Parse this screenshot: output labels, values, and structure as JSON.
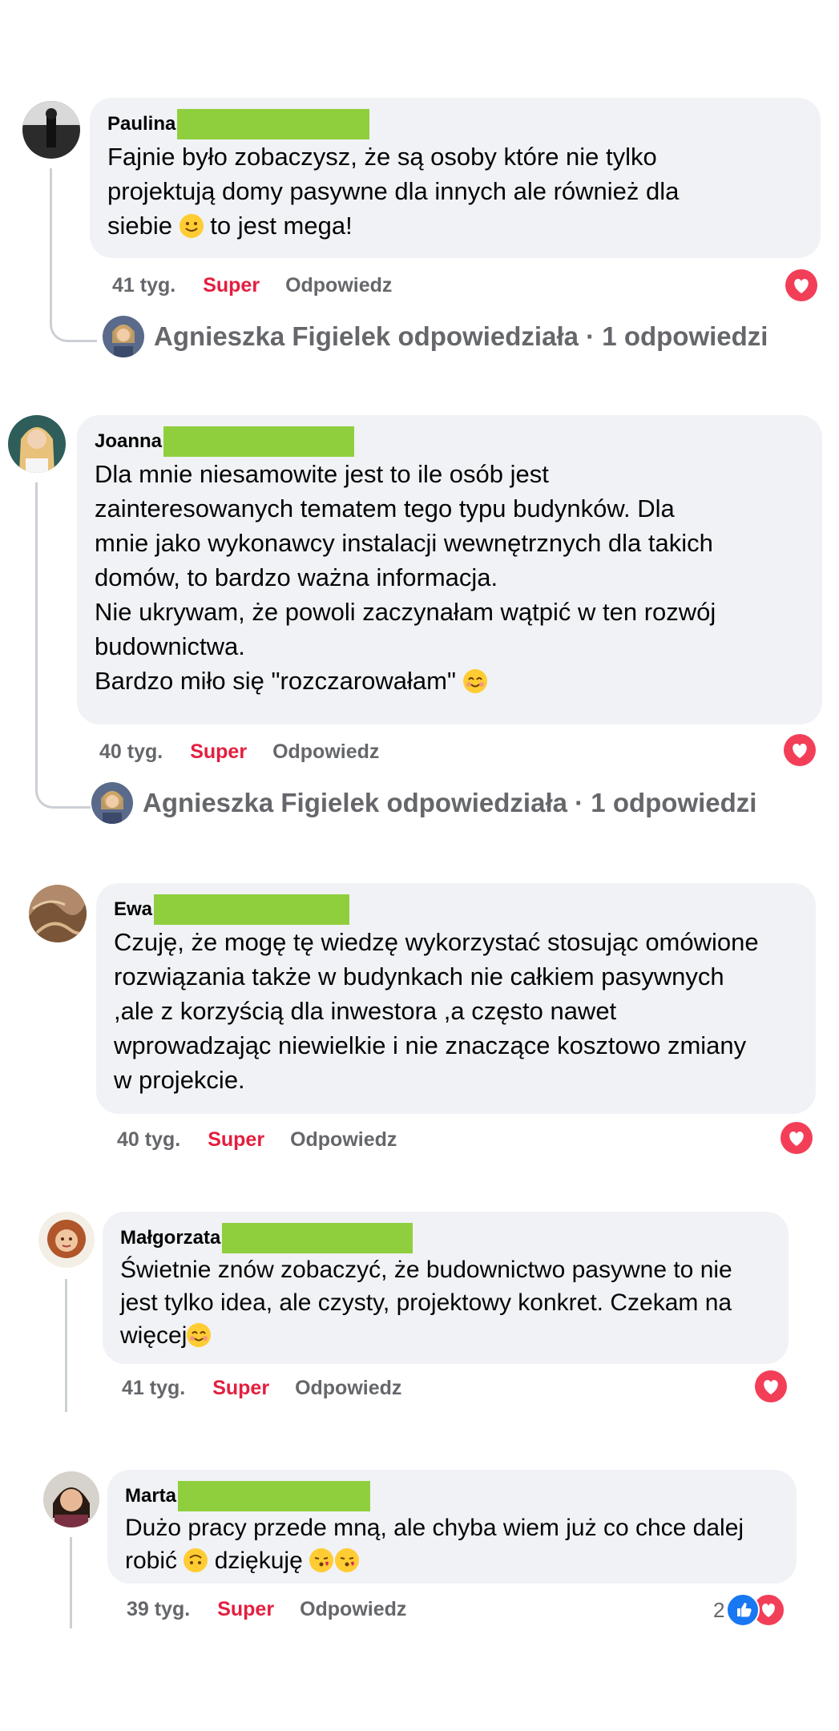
{
  "ui": {
    "reaction_label": "Super",
    "reply_label": "Odpowiedz"
  },
  "comments": [
    {
      "author": "Paulina",
      "text": "Fajnie było zobaczysz, że są osoby które nie tylko\nprojektują domy pasywne dla innych ale również dla\nsiebie ",
      "text_after_emoji": " to jest mega!",
      "time": "41 tyg.",
      "reply_summary": "Agnieszka Figielek odpowiedziała · 1 odpowiedzi"
    },
    {
      "author": "Joanna",
      "text": "Dla mnie niesamowite jest to ile osób jest\nzainteresowanych tematem tego typu budynków. Dla\nmnie jako wykonawcy instalacji wewnętrznych dla takich\ndomów, to bardzo ważna informacja.\nNie ukrywam, że powoli zaczynałam wątpić w ten rozwój\nbudownictwa.\nBardzo miło się \"rozczarowałam\" ",
      "time": "40 tyg.",
      "reply_summary": "Agnieszka Figielek odpowiedziała · 1 odpowiedzi"
    },
    {
      "author": "Ewa",
      "text": "Czuję, że mogę tę wiedzę wykorzystać stosując omówione\nrozwiązania także w budynkach nie całkiem pasywnych\n,ale z korzyścią dla inwestora ,a często nawet\nwprowadzając niewielkie i nie znaczące kosztowo zmiany\nw projekcie.",
      "time": "40 tyg."
    },
    {
      "author": "Małgorzata",
      "text": "Świetnie znów zobaczyć, że budownictwo pasywne to nie\njest tylko idea, ale czysty, projektowy konkret. Czekam na\nwięcej",
      "time": "41 tyg."
    },
    {
      "author": "Marta",
      "text": "Dużo pracy przede mną, ale chyba wiem już co chce dalej\nrobić ",
      "text_after_emoji": " dziękuję ",
      "time": "39 tyg.",
      "reaction_count": "2"
    }
  ],
  "colors": {
    "bubble": "#f0f2f5",
    "reaction": "#e41e3f",
    "muted": "#65676b",
    "redaction": "#8fcf3e",
    "heart": "#f33e58",
    "like": "#1877f2"
  }
}
